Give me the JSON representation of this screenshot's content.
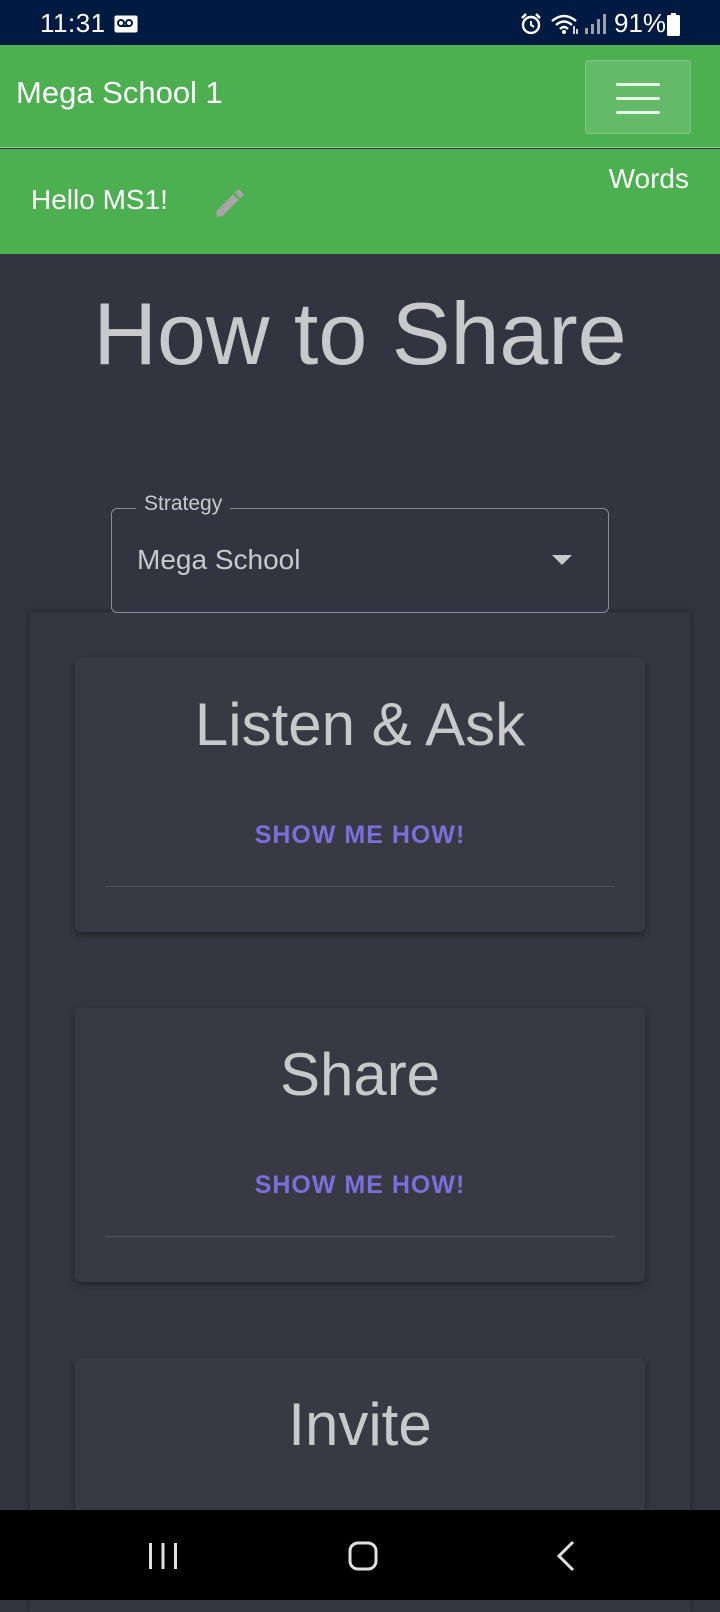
{
  "status_bar": {
    "time": "11:31",
    "battery": "91%",
    "icons": [
      "voicemail-icon",
      "alarm-icon",
      "wifi-icon",
      "signal-icon",
      "battery-icon"
    ]
  },
  "app_bar": {
    "title": "Mega School 1",
    "menu_icon": "hamburger-menu-icon",
    "color": "#4caf50"
  },
  "sub_bar": {
    "greeting": "Hello MS1!",
    "edit_icon": "pencil-icon",
    "words_link": "Words"
  },
  "page": {
    "title": "How to Share"
  },
  "strategy_select": {
    "label": "Strategy",
    "value": "Mega School"
  },
  "cards": [
    {
      "title": "Listen & Ask",
      "action": "SHOW ME HOW!"
    },
    {
      "title": "Share",
      "action": "SHOW ME HOW!"
    },
    {
      "title": "Invite"
    }
  ],
  "nav_bar": {
    "icons": [
      "recent-apps-icon",
      "home-icon",
      "back-icon"
    ]
  },
  "colors": {
    "background": "#33343f",
    "accent": "#7b6fdc",
    "header": "#4caf50"
  }
}
